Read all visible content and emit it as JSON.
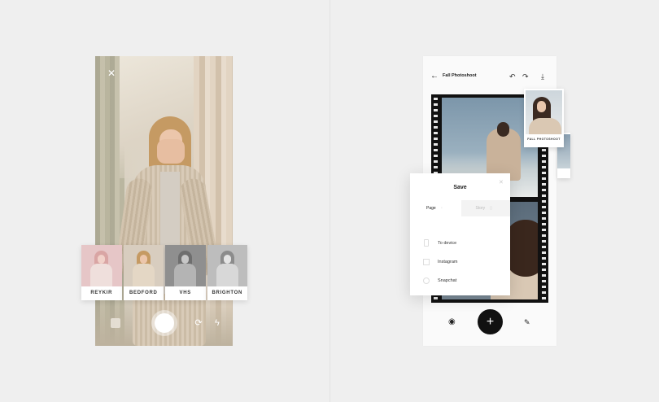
{
  "camera_screen": {
    "close_icon": "close-icon",
    "filters": [
      {
        "label": "REYKIR",
        "tint": "#e8c9cb"
      },
      {
        "label": "BEDFORD",
        "tint": "#d8cdbf"
      },
      {
        "label": "VHS",
        "tint": "#9a9a9a"
      },
      {
        "label": "BRIGHTON",
        "tint": "#c4c4c4"
      }
    ],
    "controls": {
      "gallery_icon": "gallery-icon",
      "shutter_icon": "shutter-button",
      "flip_icon": "camera-flip-icon",
      "flash_icon": "flash-icon"
    }
  },
  "editor_screen": {
    "title": "Fall Photoshoot",
    "icons": {
      "back": "arrow-left-icon",
      "undo": "undo-icon",
      "redo": "redo-icon",
      "download": "download-icon",
      "preview": "eye-icon",
      "add": "plus-icon",
      "edit": "pencil-icon"
    },
    "polaroid_caption": "FALL PHOTOSHOOT",
    "save_sheet": {
      "title": "Save",
      "tabs": [
        {
          "label": "Page",
          "active": true
        },
        {
          "label": "Story",
          "active": false
        }
      ],
      "options": [
        {
          "label": "To device",
          "icon": "phone-icon"
        },
        {
          "label": "Instagram",
          "icon": "instagram-icon"
        },
        {
          "label": "Snapchat",
          "icon": "snapchat-icon"
        }
      ]
    }
  },
  "colors": {
    "background": "#efefef",
    "accent": "#111111"
  }
}
